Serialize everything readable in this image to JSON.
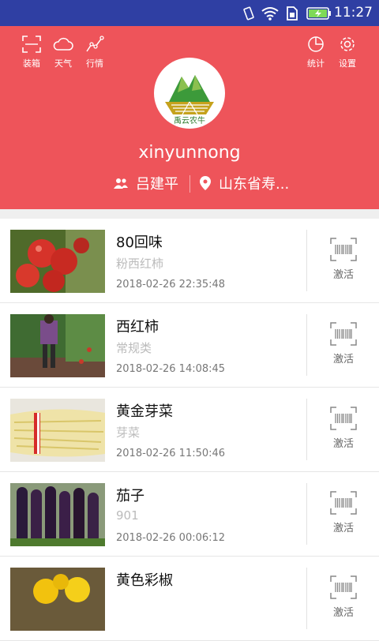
{
  "status_bar": {
    "time": "11:27"
  },
  "header": {
    "left_buttons": [
      {
        "label": "装箱",
        "icon": "scan-frame-icon"
      },
      {
        "label": "天气",
        "icon": "cloud-icon"
      },
      {
        "label": "行情",
        "icon": "trend-icon"
      }
    ],
    "right_buttons": [
      {
        "label": "统计",
        "icon": "pie-chart-icon"
      },
      {
        "label": "设置",
        "icon": "gear-icon"
      }
    ],
    "logo_text": "禹云农牛",
    "username": "xinyunnong",
    "person": "吕建平",
    "location": "山东省寿...",
    "accent": "#ee545a"
  },
  "products": [
    {
      "name": "80回味",
      "variety": "粉西红柿",
      "date": "2018-02-26 22:35:48",
      "action": "激活"
    },
    {
      "name": "西红柿",
      "variety": "常规类",
      "date": "2018-02-26 14:08:45",
      "action": "激活"
    },
    {
      "name": "黄金芽菜",
      "variety": "芽菜",
      "date": "2018-02-26 11:50:46",
      "action": "激活"
    },
    {
      "name": "茄子",
      "variety": "901",
      "date": "2018-02-26 00:06:12",
      "action": "激活"
    },
    {
      "name": "黄色彩椒",
      "variety": "",
      "date": "",
      "action": "激活"
    }
  ]
}
